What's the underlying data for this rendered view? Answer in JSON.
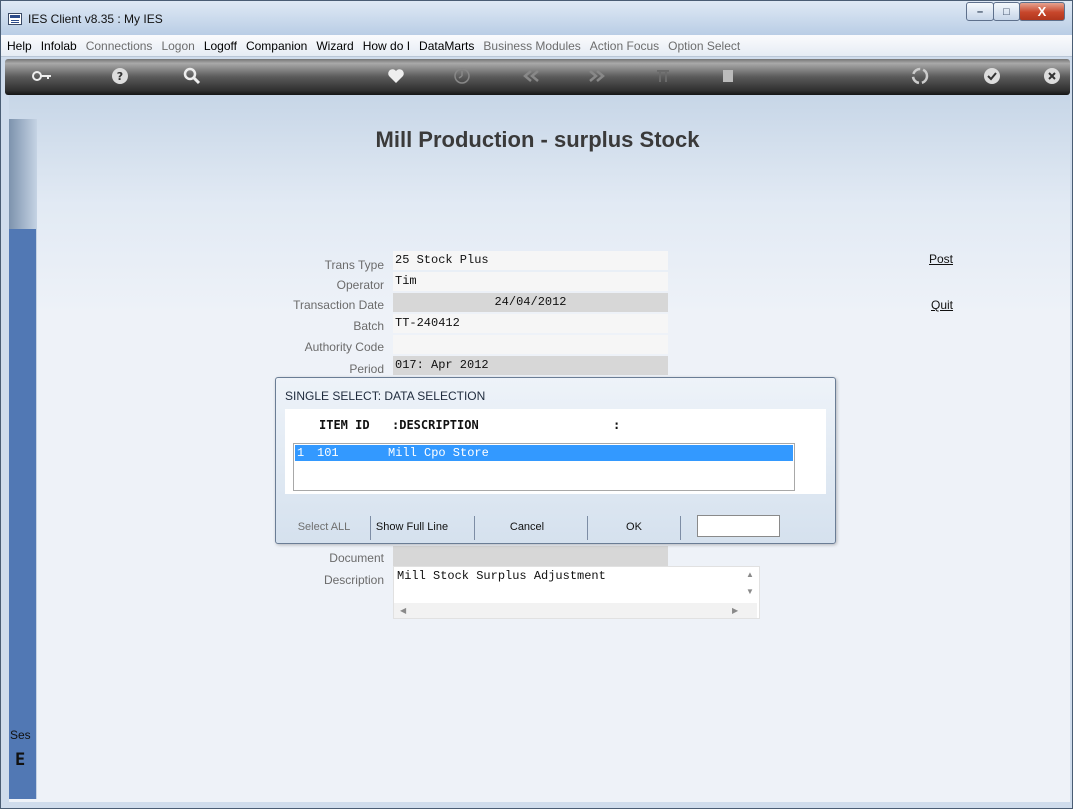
{
  "window": {
    "title": "IES Client v8.35 : My IES",
    "min_label": "–",
    "max_label": "□",
    "close_label": "X"
  },
  "menu": [
    "Help",
    "Infolab",
    "Connections",
    "Logon",
    "Logoff",
    "Companion",
    "Wizard",
    "How do I",
    "DataMarts",
    "Business Modules",
    "Action Focus",
    "Option Select"
  ],
  "menu_dim": [
    false,
    false,
    true,
    true,
    false,
    false,
    false,
    false,
    false,
    true,
    true,
    true
  ],
  "toolbar_icons": [
    "key-icon",
    "help-icon",
    "search-icon",
    "heart-icon",
    "clock-icon",
    "rewind-icon",
    "fast-forward-icon",
    "tools-icon",
    "page-icon",
    "recycle-icon",
    "check-icon",
    "close-icon"
  ],
  "page": {
    "title": "Mill Production - surplus Stock"
  },
  "form": {
    "trans_type": {
      "label": "Trans Type",
      "value": "25 Stock Plus"
    },
    "operator": {
      "label": "Operator",
      "value": "Tim"
    },
    "transaction_date": {
      "label": "Transaction Date",
      "value": "24/04/2012"
    },
    "batch": {
      "label": "Batch",
      "value": "TT-240412"
    },
    "authority_code": {
      "label": "Authority Code",
      "value": ""
    },
    "period": {
      "label": "Period",
      "value": "017: Apr 2012"
    },
    "document": {
      "label": "Document",
      "value": ""
    },
    "description": {
      "label": "Description",
      "value": "Mill Stock Surplus Adjustment"
    }
  },
  "actions": {
    "post": "Post",
    "quit": "Quit"
  },
  "dialog": {
    "title": "SINGLE SELECT: DATA SELECTION",
    "headers": {
      "item_id": "ITEM ID",
      "description": ":DESCRIPTION",
      "extra": ":"
    },
    "rows": [
      {
        "num": "1",
        "item_id": "101",
        "description": "Mill Cpo Store"
      }
    ],
    "buttons": {
      "select_all": "Select ALL",
      "show_full_line": "Show Full Line",
      "cancel": "Cancel",
      "ok": "OK"
    },
    "input_value": ""
  },
  "sidebar": {
    "session_label": "Ses",
    "glyph": "E"
  }
}
